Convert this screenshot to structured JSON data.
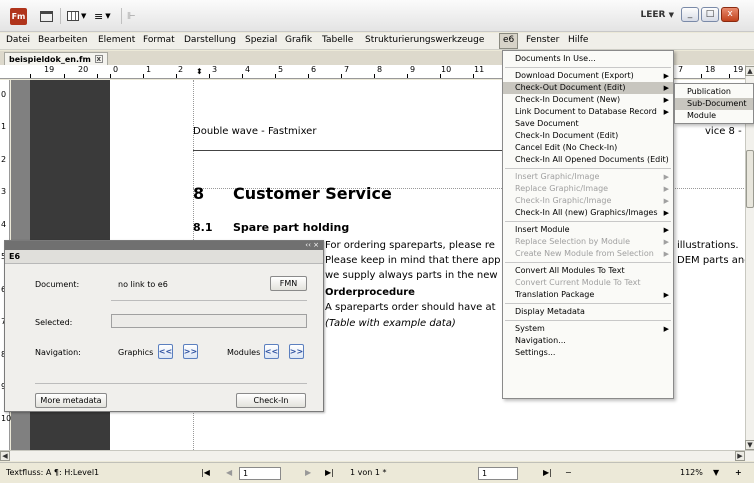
{
  "app": {
    "logo": "Fm",
    "workspace": "LEER",
    "window_buttons": [
      "_",
      "□",
      "x"
    ]
  },
  "menubar": {
    "items": [
      "Datei",
      "Bearbeiten",
      "Element",
      "Format",
      "Darstellung",
      "Spezial",
      "Grafik",
      "Tabelle",
      "Strukturierungswerkzeuge",
      "e6",
      "Fenster",
      "Hilfe"
    ],
    "active": "e6"
  },
  "document_tab": {
    "title": "beispieldok_en.fm",
    "close": "x"
  },
  "ruler": {
    "numbers": [
      "19",
      "20",
      "0",
      "1",
      "2",
      "3",
      "4",
      "5",
      "6",
      "7",
      "8",
      "9",
      "10",
      "11",
      "7",
      "18",
      "19"
    ]
  },
  "vruler": {
    "numbers": [
      "0",
      "1",
      "2",
      "3",
      "4",
      "5",
      "6",
      "7",
      "8",
      "9",
      "10"
    ]
  },
  "document": {
    "header_left": "Double wave - Fastmixer",
    "header_right": "vice   8 - 1",
    "chapter_number": "8",
    "chapter_title": "Customer Service",
    "section_number": "8.1",
    "section_title": "Spare part holding",
    "para1_line1": "For ordering spareparts, please re",
    "para1_line1_right": "illustrations.",
    "para1_line2": "Please keep in mind that there app",
    "para1_line2_right": "DEM parts and",
    "para1_line3": "we supply always parts in the new",
    "subheading": "Orderprocedure",
    "para2": "A spareparts order should have at",
    "italic_note": "(Table with example data)"
  },
  "e6_menu": {
    "items": [
      {
        "label": "Documents In Use...",
        "arrow": false,
        "disabled": false
      },
      {
        "sep": true
      },
      {
        "label": "Download Document (Export)",
        "arrow": true,
        "disabled": false
      },
      {
        "label": "Check-Out Document (Edit)",
        "arrow": true,
        "disabled": false,
        "highlight": true
      },
      {
        "label": "Check-In Document (New)",
        "arrow": true,
        "disabled": false
      },
      {
        "label": "Link Document to Database Record",
        "arrow": true,
        "disabled": false
      },
      {
        "label": "Save Document",
        "arrow": false,
        "disabled": false
      },
      {
        "label": "Check-In Document (Edit)",
        "arrow": false,
        "disabled": false
      },
      {
        "label": "Cancel Edit (No Check-In)",
        "arrow": false,
        "disabled": false
      },
      {
        "label": "Check-In All Opened Documents (Edit)",
        "arrow": false,
        "disabled": false
      },
      {
        "sep": true
      },
      {
        "label": "Insert Graphic/Image",
        "arrow": true,
        "disabled": true
      },
      {
        "label": "Replace Graphic/Image",
        "arrow": true,
        "disabled": true
      },
      {
        "label": "Check-In Graphic/Image",
        "arrow": true,
        "disabled": true
      },
      {
        "label": "Check-In All (new) Graphics/Images",
        "arrow": true,
        "disabled": false
      },
      {
        "sep": true
      },
      {
        "label": "Insert Module",
        "arrow": true,
        "disabled": false
      },
      {
        "label": "Replace Selection by Module",
        "arrow": true,
        "disabled": true
      },
      {
        "label": "Create New Module from Selection",
        "arrow": true,
        "disabled": true
      },
      {
        "sep": true
      },
      {
        "label": "Convert All Modules To Text",
        "arrow": false,
        "disabled": false
      },
      {
        "label": "Convert Current Module To Text",
        "arrow": false,
        "disabled": true
      },
      {
        "label": "Translation Package",
        "arrow": true,
        "disabled": false
      },
      {
        "sep": true
      },
      {
        "label": "Display Metadata",
        "arrow": false,
        "disabled": false
      },
      {
        "sep": true
      },
      {
        "label": "System",
        "arrow": true,
        "disabled": false
      },
      {
        "label": "Navigation...",
        "arrow": false,
        "disabled": false
      },
      {
        "label": "Settings...",
        "arrow": false,
        "disabled": false
      }
    ]
  },
  "submenu": {
    "items": [
      {
        "label": "Publication",
        "highlight": false
      },
      {
        "label": "Sub-Document",
        "highlight": true
      },
      {
        "label": "Module",
        "highlight": false
      }
    ]
  },
  "panel": {
    "tab_label": "E6",
    "title_controls": "‹‹ ×",
    "document_label": "Document:",
    "document_value": "no link to e6",
    "fmn_button": "FMN",
    "selected_label": "Selected:",
    "selected_value": "",
    "navigation_label": "Navigation:",
    "graphics_label": "Graphics",
    "modules_label": "Modules",
    "prev": "<<",
    "next": ">>",
    "more_metadata": "More metadata",
    "checkin": "Check-In"
  },
  "statusbar": {
    "flow": "Textfluss: A  ¶: H:Level1",
    "page_input": "1",
    "page_count": "1 von 1 *",
    "second_input": "1",
    "minus": "−",
    "zoom": "112%",
    "plus": "+"
  },
  "colors": {
    "logo_bg": "#b0341b",
    "menu_highlight": "#c8c6bf",
    "dark_strip": "#3a3a3a",
    "nav_button_text": "#2c4f9e"
  }
}
